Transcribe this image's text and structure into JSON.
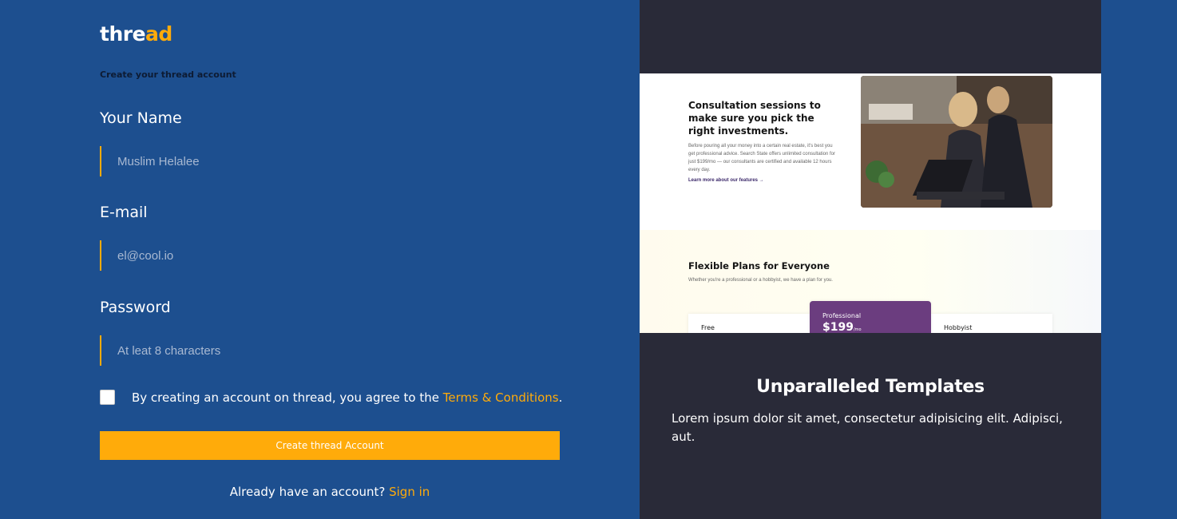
{
  "logo": {
    "part1": "thre",
    "part2": "ad"
  },
  "subtitle": "Create your thread account",
  "form": {
    "name": {
      "label": "Your Name",
      "placeholder": "Muslim Helalee"
    },
    "email": {
      "label": "E-mail",
      "placeholder": "el@cool.io"
    },
    "password": {
      "label": "Password",
      "placeholder": "At leat 8 characters"
    },
    "terms": {
      "text": "By creating an account on thread, you agree to the ",
      "link": "Terms & Conditions",
      "end": "."
    },
    "submit_label": "Create thread Account",
    "signin": {
      "text": "Already have an account? ",
      "link": "Sign in"
    }
  },
  "preview": {
    "heading": "Consultation sessions to make sure you pick the right investments.",
    "body": "Before pouring all your money into a certain real estate, it's best you get professional advice. Search State offers unlimited consultation for just $199/mo — our consultants are certified and available 12 hours every day.",
    "link": "Learn more about our features →",
    "plans_title": "Flexible Plans for Everyone",
    "plans_sub": "Whether you're a professional or a hobbyist, we have a plan for you.",
    "plans": [
      {
        "name": "Free"
      },
      {
        "name": "Professional",
        "price": "$199",
        "per": "/mo"
      },
      {
        "name": "Hobbyist"
      }
    ]
  },
  "panel": {
    "title": "Unparalleled Templates",
    "body": "Lorem ipsum dolor sit amet, consectetur adipisicing elit. Adipisci, aut."
  },
  "colors": {
    "background": "#1d4f8f",
    "accent": "#ffab0a",
    "panel": "#292a38"
  }
}
